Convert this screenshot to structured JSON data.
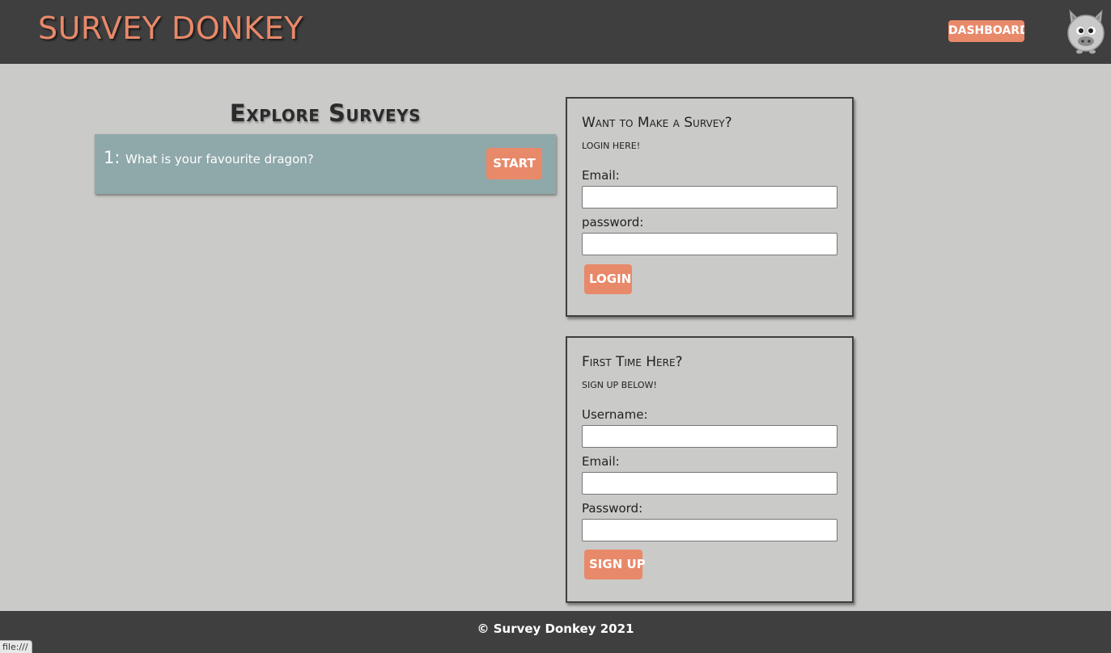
{
  "header": {
    "title": "SURVEY DONKEY",
    "dashboard_label": "DASHBOARD",
    "logo_icon": "donkey-logo-icon"
  },
  "explore": {
    "title": "Explore Surveys",
    "surveys": [
      {
        "number": "1:",
        "question": "What is your favourite dragon?",
        "start_label": "START"
      }
    ]
  },
  "login_panel": {
    "title": "Want to Make a Survey?",
    "subtitle": "LOGIN HERE!",
    "email_label": "Email:",
    "email_value": "",
    "password_label": "password:",
    "password_value": "",
    "button_label": "LOGIN"
  },
  "signup_panel": {
    "title": "First Time Here?",
    "subtitle": "SIGN UP BELOW!",
    "username_label": "Username:",
    "username_value": "",
    "email_label": "Email:",
    "email_value": "",
    "password_label": "Password:",
    "password_value": "",
    "button_label": "SIGN UP"
  },
  "footer": {
    "text": "© Survey Donkey 2021"
  },
  "status_bar": {
    "url": "file:///"
  },
  "colors": {
    "accent": "#e8896a",
    "header_bg": "#3f3f3f",
    "page_bg": "#cacac8",
    "card_bg": "#8fa8aa"
  }
}
